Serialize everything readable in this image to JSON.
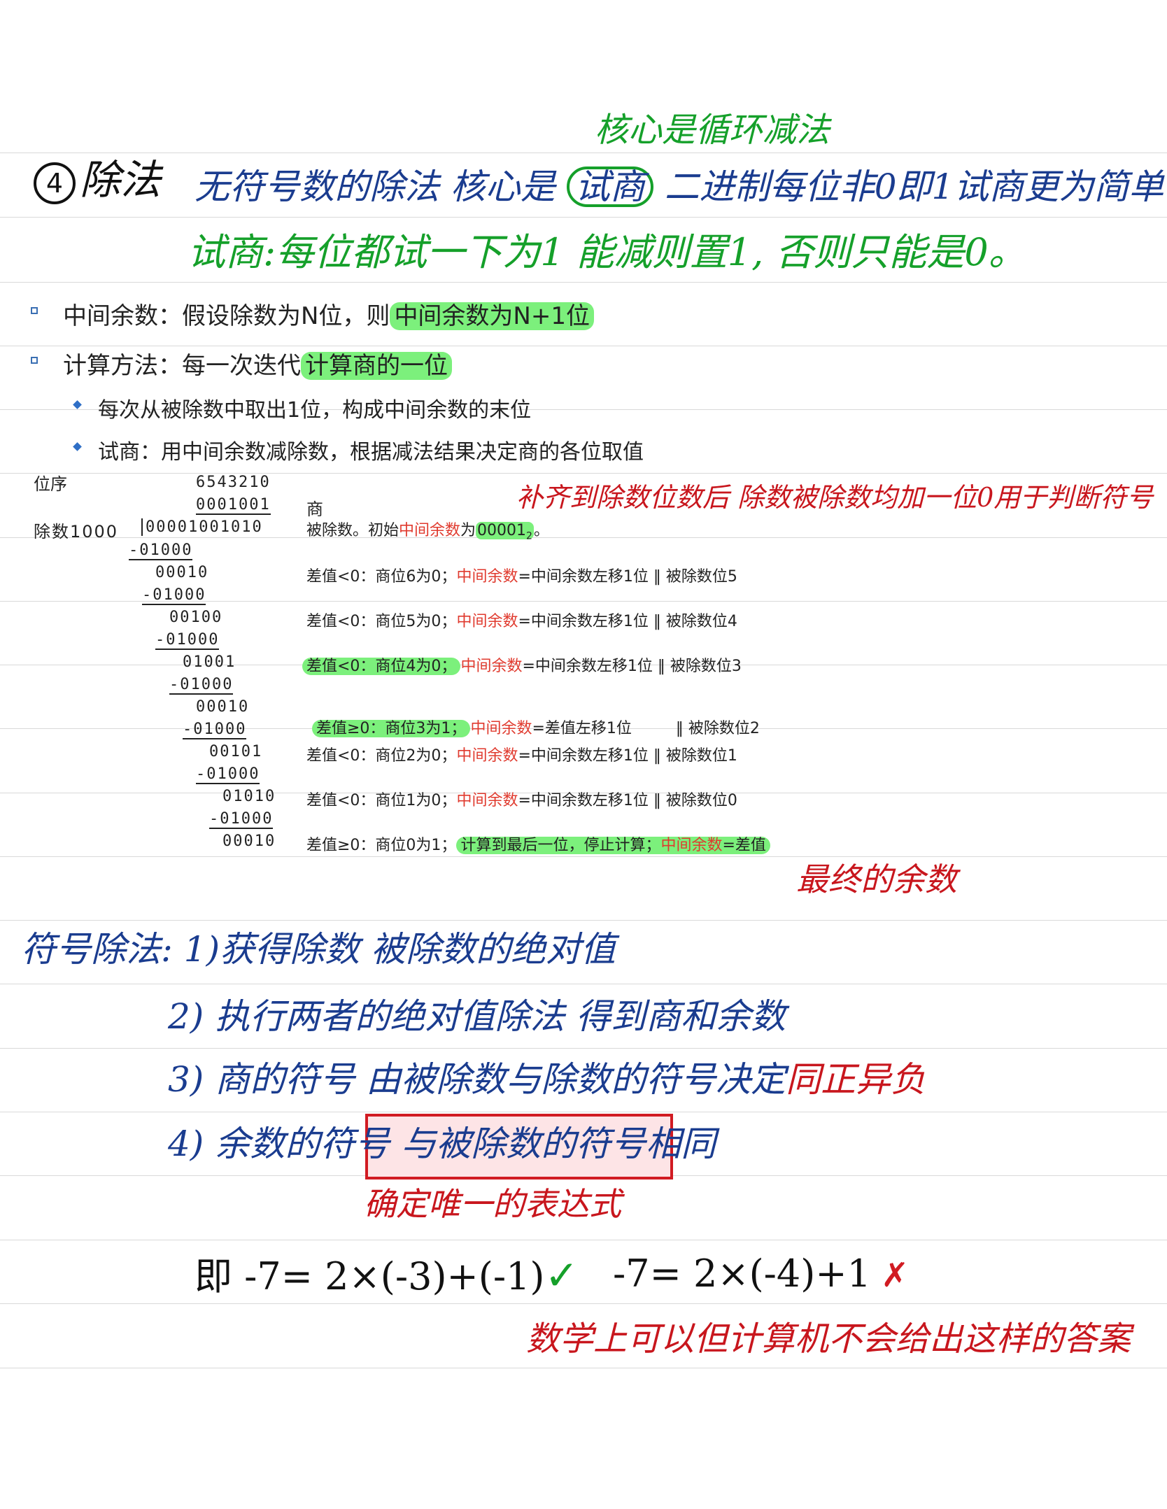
{
  "top_note": "核心是循环减法",
  "title": {
    "circled_number": "4",
    "label": "除法"
  },
  "line1": {
    "text_before": "无符号数的除法 核心是",
    "circled_word": "试商",
    "text_after": "二进制每位非0即1试商更为简单"
  },
  "line2": "试商:每位都试一下为1 能减则置1, 否则只能是0。",
  "bullets": [
    {
      "label": "中间余数：假设除数为N位，则",
      "highlight": "中间余数为N+1位"
    },
    {
      "label": "计算方法：每一次迭代",
      "highlight": "计算商的一位"
    }
  ],
  "sub_bullets": [
    "每次从被除数中取出1位，构成中间余数的末位",
    "试商：用中间余数减除数，根据减法结果决定商的各位取值"
  ],
  "division": {
    "order_label": "位序",
    "order_digits": "6543210",
    "quotient": "0001001",
    "quotient_label": "商",
    "divisor_label": "除数1000",
    "dividend": "00001001010",
    "dividend_label_prefix": "被除数。初始",
    "dividend_label_red": "中间余数",
    "dividend_label_mid": "为",
    "dividend_label_value": "00001",
    "dividend_label_sub": "2",
    "dividend_label_end": "。",
    "align_note": "补齐到除数位数后 除数被除数均加一位0用于判断符号",
    "rows": [
      {
        "sub": "-01000",
        "rem": "00010",
        "note_lead": "差值<0：商位6为0；",
        "note_red": "中间余数",
        "note_tail": "=中间余数左移1位 ‖ 被除数位5",
        "lead_hl": false
      },
      {
        "sub": "-01000",
        "rem": "00100",
        "note_lead": "差值<0：商位5为0；",
        "note_red": "中间余数",
        "note_tail": "=中间余数左移1位 ‖ 被除数位4",
        "lead_hl": false
      },
      {
        "sub": "-01000",
        "rem": "01001",
        "note_lead": "差值<0：商位4为0；",
        "note_red": "中间余数",
        "note_tail": "=中间余数左移1位 ‖ 被除数位3",
        "lead_hl": true
      },
      {
        "sub": "-01000",
        "rem": "00010",
        "note_lead": "差值≥0：商位3为1；",
        "note_red": "中间余数",
        "note_tail": "=差值左移1位         ‖ 被除数位2",
        "lead_hl": true
      },
      {
        "sub": "-01000",
        "rem": "00101",
        "note_lead": "差值<0：商位2为0；",
        "note_red": "中间余数",
        "note_tail": "=中间余数左移1位 ‖ 被除数位1",
        "lead_hl": false
      },
      {
        "sub": "-01000",
        "rem": "01010",
        "note_lead": "差值<0：商位1为0；",
        "note_red": "中间余数",
        "note_tail": "=中间余数左移1位 ‖ 被除数位0",
        "lead_hl": false
      },
      {
        "sub": "-01000",
        "rem": "00010",
        "note_lead": "差值≥0：商位0为1；",
        "note_red": "",
        "note_tail": "",
        "lead_hl": false
      }
    ],
    "last_note_hl_a": "计算到最后一位，停止计算；",
    "last_note_hl_red": "中间余数",
    "last_note_hl_b": "=差值"
  },
  "final_remainder_note": "最终的余数",
  "signed": {
    "heading": "符号除法:",
    "step1": "1)获得除数 被除数的绝对值",
    "step2": "2) 执行两者的绝对值除法 得到商和余数",
    "step3_blue": "3) 商的符号 由被除数与除数的符号决定",
    "step3_red": "同正异负",
    "step4_blue": "4) 余数的符号",
    "step4_boxed": "与被除数的符号相同",
    "unique_note": "确定唯一的表达式",
    "example_ok": "即 -7= 2×(-3)+(-1)",
    "check": "✓",
    "example_bad": "-7= 2×(-4)+1",
    "cross": "✗",
    "math_note": "数学上可以但计算机不会给出这样的答案"
  }
}
